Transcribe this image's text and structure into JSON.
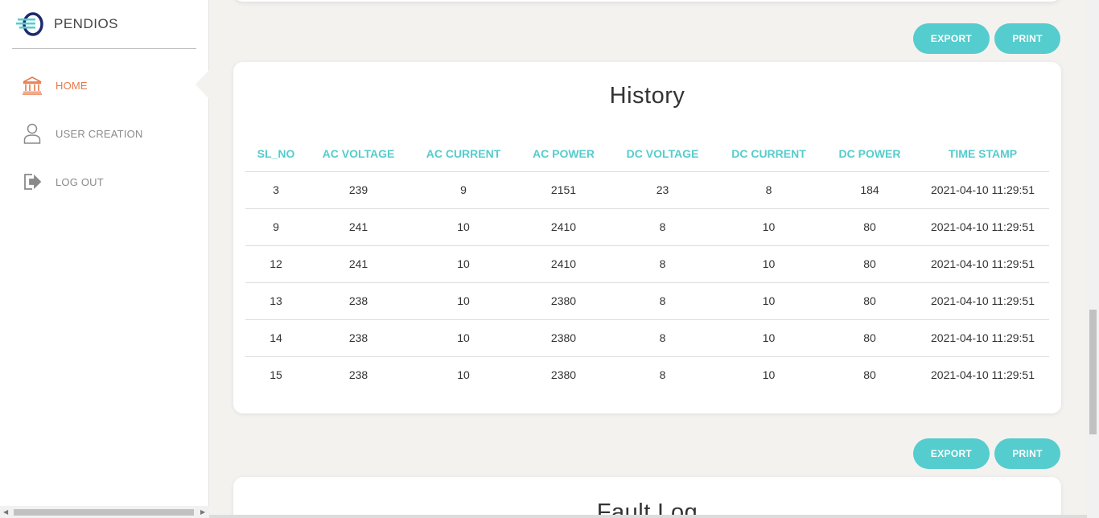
{
  "brand": {
    "name": "PENDIOS",
    "logo_icon": "pendios-logo"
  },
  "sidebar": {
    "items": [
      {
        "label": "HOME",
        "icon": "bank-icon",
        "active": true
      },
      {
        "label": "USER CREATION",
        "icon": "user-icon",
        "active": false
      },
      {
        "label": "LOG OUT",
        "icon": "logout-icon",
        "active": false
      }
    ]
  },
  "actions_top": {
    "export_label": "EXPORT",
    "print_label": "PRINT"
  },
  "history": {
    "title": "History",
    "columns": [
      "SL_NO",
      "AC VOLTAGE",
      "AC CURRENT",
      "AC POWER",
      "DC VOLTAGE",
      "DC CURRENT",
      "DC POWER",
      "TIME STAMP"
    ],
    "rows": [
      [
        "3",
        "239",
        "9",
        "2151",
        "23",
        "8",
        "184",
        "2021-04-10 11:29:51"
      ],
      [
        "9",
        "241",
        "10",
        "2410",
        "8",
        "10",
        "80",
        "2021-04-10 11:29:51"
      ],
      [
        "12",
        "241",
        "10",
        "2410",
        "8",
        "10",
        "80",
        "2021-04-10 11:29:51"
      ],
      [
        "13",
        "238",
        "10",
        "2380",
        "8",
        "10",
        "80",
        "2021-04-10 11:29:51"
      ],
      [
        "14",
        "238",
        "10",
        "2380",
        "8",
        "10",
        "80",
        "2021-04-10 11:29:51"
      ],
      [
        "15",
        "238",
        "10",
        "2380",
        "8",
        "10",
        "80",
        "2021-04-10 11:29:51"
      ]
    ]
  },
  "actions_bottom": {
    "export_label": "EXPORT",
    "print_label": "PRINT"
  },
  "fault_log": {
    "title": "Fault Log"
  },
  "colors": {
    "accent": "#55cccd",
    "active_nav": "#e8784a",
    "background": "#f3f2ef"
  }
}
